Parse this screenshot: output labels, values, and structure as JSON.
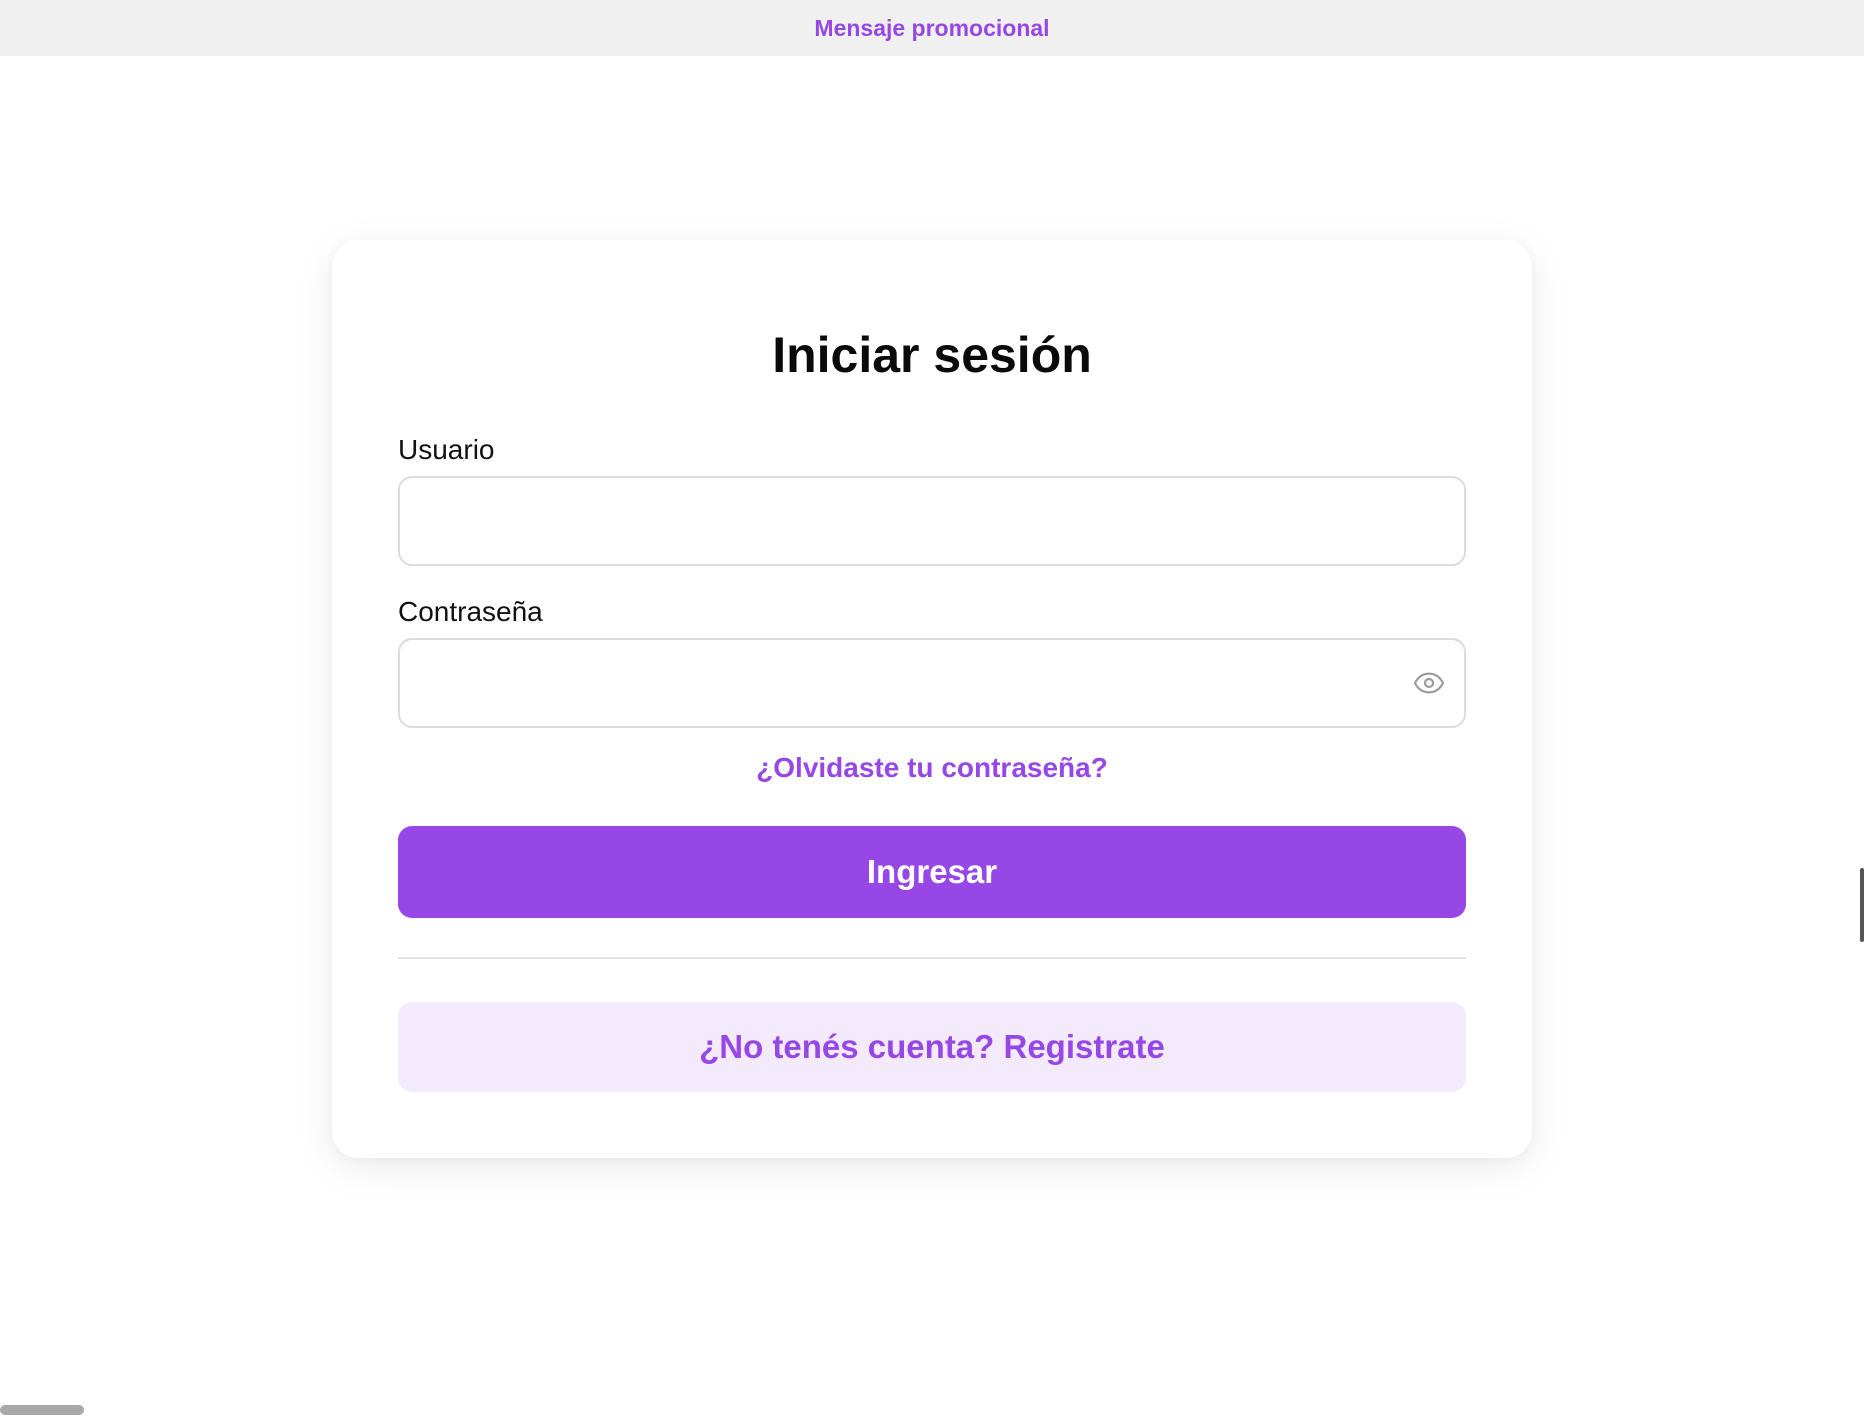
{
  "promo": {
    "text": "Mensaje promocional"
  },
  "login": {
    "title": "Iniciar sesión",
    "username": {
      "label": "Usuario",
      "value": "",
      "placeholder": ""
    },
    "password": {
      "label": "Contraseña",
      "value": "",
      "placeholder": "",
      "toggle_icon": "eye-icon"
    },
    "forgot_link": "¿Olvidaste tu contraseña?",
    "submit_label": "Ingresar",
    "register_label": "¿No tenés cuenta? Registrate"
  },
  "colors": {
    "accent": "#9747e6",
    "accent_soft": "#f3ebfb",
    "promo_bg": "#f0f0f0",
    "input_border": "#dcdcdc"
  }
}
